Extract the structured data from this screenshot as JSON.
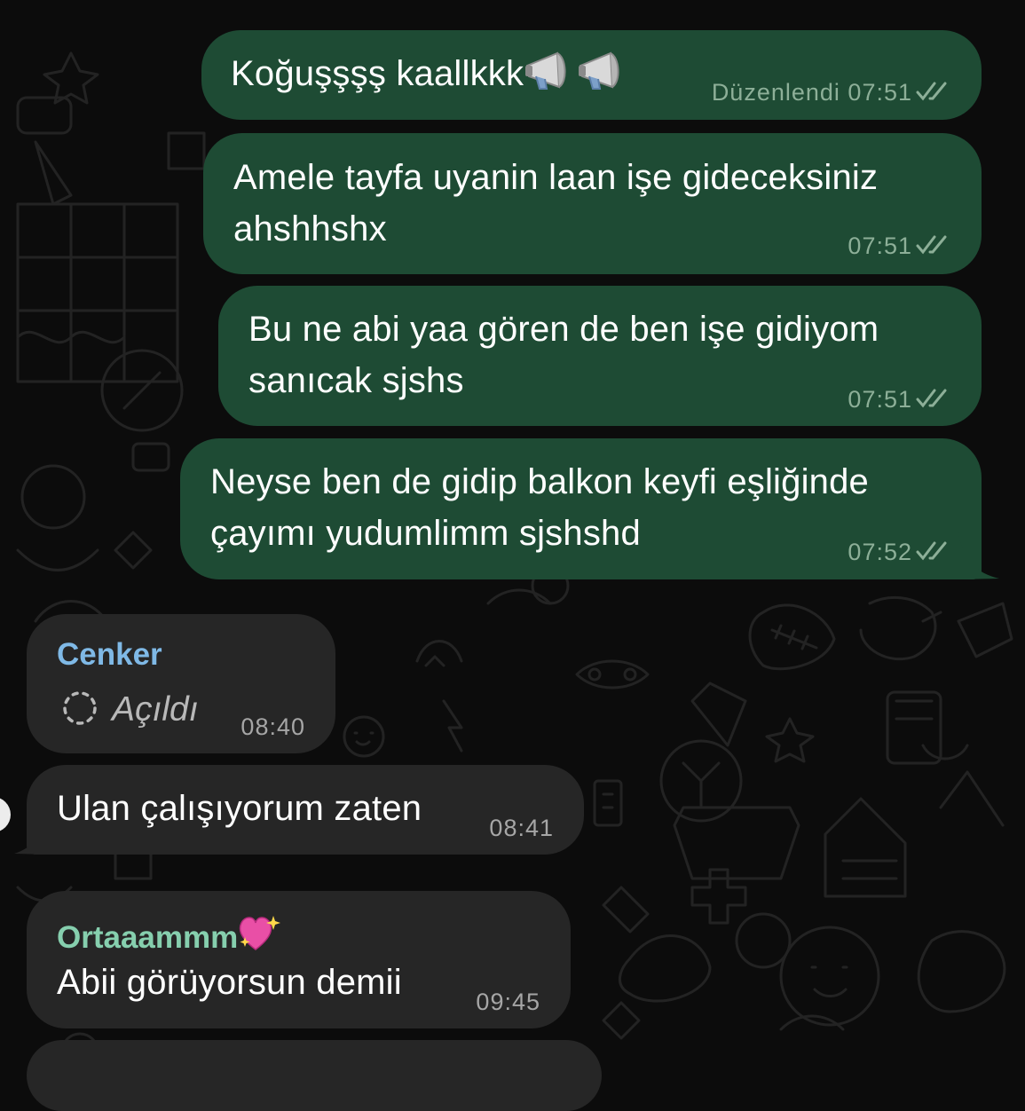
{
  "colors": {
    "background": "#0c0c0c",
    "outgoing_bubble": "#1e4b34",
    "incoming_bubble": "#262626",
    "sender_cenker": "#7fb9e6",
    "sender_ortaaammm": "#86cfae"
  },
  "messages": [
    {
      "direction": "out",
      "text": "Koğuşşşş kaallkkk",
      "emoji": [
        "megaphone-icon",
        "megaphone-icon"
      ],
      "edited_label": "Düzenlendi",
      "time": "07:51",
      "status_icon": "double-check-icon"
    },
    {
      "direction": "out",
      "line1": "Amele tayfa uyanin laan işe gideceksiniz",
      "line2": "ahshhshx",
      "time": "07:51",
      "status_icon": "double-check-icon"
    },
    {
      "direction": "out",
      "line1": "Bu ne abi yaa gören de ben işe gidiyom",
      "line2": "sanıcak sjshs",
      "time": "07:51",
      "status_icon": "double-check-icon"
    },
    {
      "direction": "out",
      "line1": "Neyse ben de gidip balkon keyfi eşliğinde",
      "line2": "çayımı yudumlimm sjshshd",
      "time": "07:52",
      "status_icon": "double-check-icon"
    },
    {
      "direction": "in",
      "sender": "Cenker",
      "status_text": "Açıldı",
      "status_icon": "view-once-spinner-icon",
      "time": "08:40"
    },
    {
      "direction": "in",
      "text": "Ulan çalışıyorum zaten",
      "time": "08:41"
    },
    {
      "direction": "in",
      "sender": "Ortaaammm",
      "sender_emoji": "sparkling-heart-icon",
      "text": "Abii görüyorsun demii",
      "time": "09:45"
    }
  ]
}
